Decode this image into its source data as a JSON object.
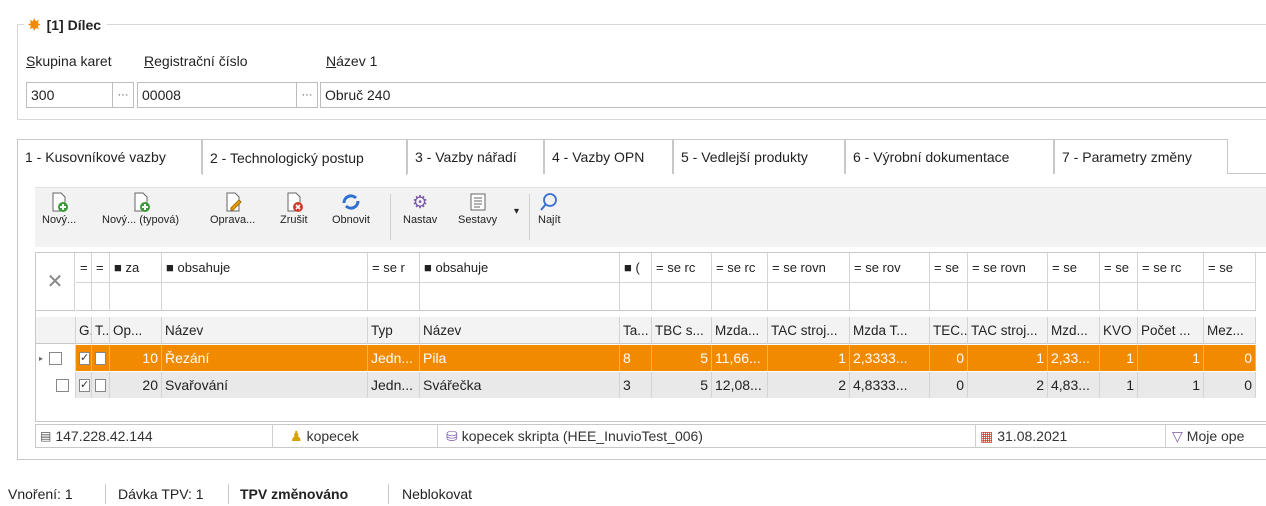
{
  "header": {
    "title": "[1] Dílec",
    "labels": {
      "skupina": "Skupina karet",
      "registracni": "Registrační číslo",
      "nazev1": "Název 1"
    },
    "values": {
      "skupina": "300",
      "registracni": "00008",
      "nazev1": "Obruč 240"
    },
    "ellipsis": "···"
  },
  "tabs": [
    "1 - Kusovníkové vazby",
    "2 - Technologický postup",
    "3 - Vazby nářadí",
    "4 - Vazby OPN",
    "5 - Vedlejší produkty",
    "6 - Výrobní dokumentace",
    "7 - Parametry změny"
  ],
  "toolbar": {
    "new": "Nový...",
    "new_typed": "Nový... (typová)",
    "edit": "Oprava...",
    "cancel": "Zrušit",
    "refresh": "Obnovit",
    "settings": "Nastav",
    "reports": "Sestavy",
    "find": "Najít"
  },
  "filter": [
    "=",
    "=",
    "■ za",
    "■ obsahuje",
    "= se r",
    "■ obsahuje",
    "■ (",
    "= se rc",
    "= se rc",
    "= se rovn",
    "= se rov",
    "= se",
    "= se rovn",
    "= se",
    "= se",
    "= se rc",
    "= se"
  ],
  "columns": [
    "G..",
    "T...",
    "Op...",
    "Název",
    "Typ",
    "Název",
    "Ta...",
    "TBC s...",
    "Mzda...",
    "TAC stroj...",
    "Mzda T...",
    "TEC...",
    "TAC stroj...",
    "Mzd...",
    "KVO",
    "Počet ...",
    "Mez..."
  ],
  "rows": [
    {
      "op": "10",
      "nazev": "Řezání",
      "typ": "Jedn...",
      "nazev2": "Pila",
      "ta": "8",
      "tbc": "5",
      "mzda": "11,66...",
      "tac": "1",
      "mzdat": "2,3333...",
      "tec": "0",
      "tac2": "1",
      "mzd": "2,33...",
      "kvo": "1",
      "pocet": "1",
      "mez": "0"
    },
    {
      "op": "20",
      "nazev": "Svařování",
      "typ": "Jedn...",
      "nazev2": "Svářečka",
      "ta": "3",
      "tbc": "5",
      "mzda": "12,08...",
      "tac": "2",
      "mzdat": "4,8333...",
      "tec": "0",
      "tac2": "2",
      "mzd": "4,83...",
      "kvo": "1",
      "pocet": "1",
      "mez": "0"
    }
  ],
  "status": {
    "ip": "147.228.42.144",
    "user": "kopecek",
    "db": "kopecek skripta (HEE_InuvioTest_006)",
    "date": "31.08.2021",
    "filter": "Moje ope"
  },
  "bottom": {
    "vnoreni": "Vnoření: 1",
    "davka": "Dávka TPV: 1",
    "zmeneno": "TPV změnováno",
    "blok": "Neblokovat"
  },
  "colors": {
    "accent": "#f28a00",
    "selected_row": "#f28a00",
    "alt_row": "#e9e9e9"
  }
}
